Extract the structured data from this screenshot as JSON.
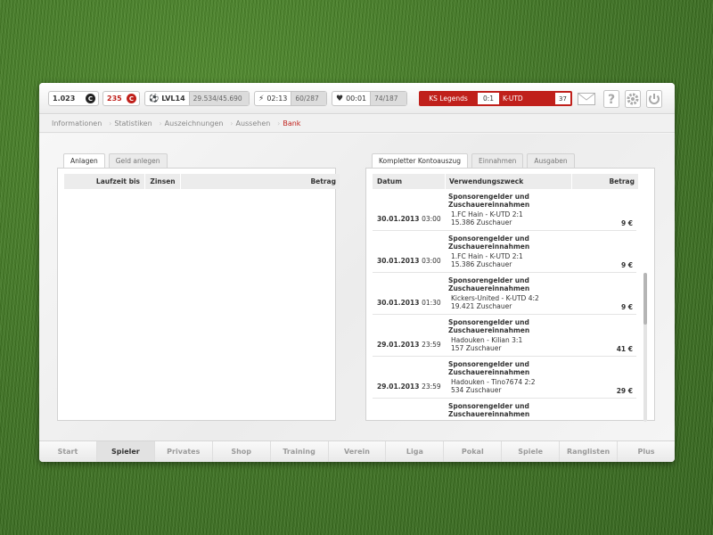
{
  "topbar": {
    "coins": "1.023",
    "coins_icon": "C",
    "credits": "235",
    "credits_icon": "C",
    "level": "LVL14",
    "xp": "29.534/45.690",
    "energy_time": "02:13",
    "energy": "60/287",
    "health_time": "00:01",
    "health": "74/187",
    "match": {
      "home": "KS Legends",
      "score": "0:1",
      "away": "K-UTD",
      "minute": "37"
    }
  },
  "breadcrumb": [
    "Informationen",
    "Statistiken",
    "Auszeichnungen",
    "Aussehen",
    "Bank"
  ],
  "left": {
    "tabs": [
      "Anlagen",
      "Geld anlegen"
    ],
    "columns": [
      "Laufzeit bis",
      "Zinsen",
      "Betrag"
    ]
  },
  "right": {
    "tabs": [
      "Kompletter Kontoauszug",
      "Einnahmen",
      "Ausgaben"
    ],
    "columns": [
      "Datum",
      "Verwendungszweck",
      "Betrag"
    ],
    "rows": [
      {
        "date": "30.01.2013",
        "time": "03:00",
        "title": "Sponsorengelder und Zuschauereinnahmen",
        "detail1": "1.FC Hain - K-UTD 2:1",
        "detail2": "15.386 Zuschauer",
        "amount": "9 €"
      },
      {
        "date": "30.01.2013",
        "time": "03:00",
        "title": "Sponsorengelder und Zuschauereinnahmen",
        "detail1": "1.FC Hain - K-UTD 2:1",
        "detail2": "15.386 Zuschauer",
        "amount": "9 €"
      },
      {
        "date": "30.01.2013",
        "time": "01:30",
        "title": "Sponsorengelder und Zuschauereinnahmen",
        "detail1": "Kickers-United - K-UTD 4:2",
        "detail2": "19.421 Zuschauer",
        "amount": "9 €"
      },
      {
        "date": "29.01.2013",
        "time": "23:59",
        "title": "Sponsorengelder und Zuschauereinnahmen",
        "detail1": "Hadouken - Kilian 3:1",
        "detail2": "157 Zuschauer",
        "amount": "41 €"
      },
      {
        "date": "29.01.2013",
        "time": "23:59",
        "title": "Sponsorengelder und Zuschauereinnahmen",
        "detail1": "Hadouken - Tino7674 2:2",
        "detail2": "534 Zuschauer",
        "amount": "29 €"
      },
      {
        "date": "",
        "time": "",
        "title": "Sponsorengelder und Zuschauereinnahmen",
        "detail1": "",
        "detail2": "",
        "amount": ""
      }
    ]
  },
  "nav": [
    "Start",
    "Spieler",
    "Privates",
    "Shop",
    "Training",
    "Verein",
    "Liga",
    "Pokal",
    "Spiele",
    "Ranglisten",
    "Plus"
  ]
}
